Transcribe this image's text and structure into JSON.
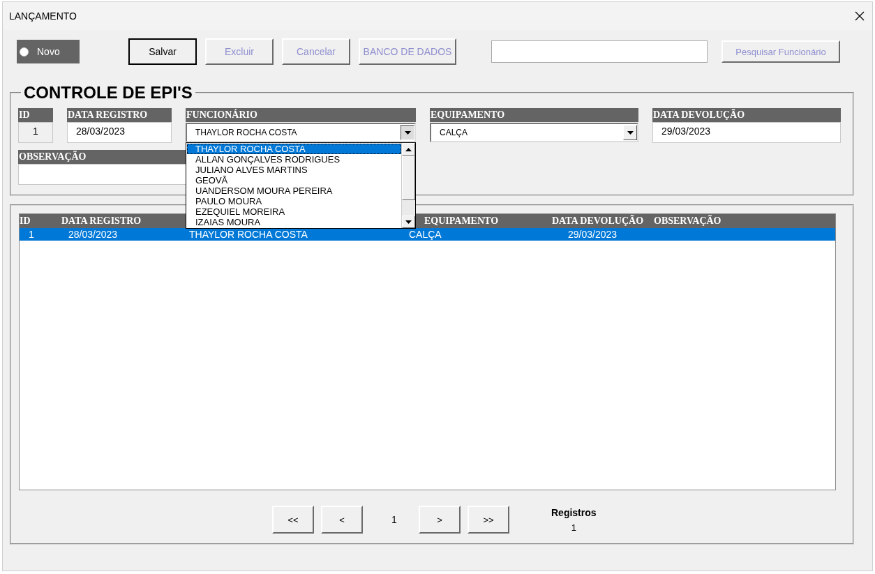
{
  "window": {
    "title": "LANÇAMENTO"
  },
  "toolbar": {
    "novo": {
      "label": "Novo",
      "checked": false
    },
    "buttons": [
      {
        "label": "Salvar",
        "disabled": false,
        "default": true
      },
      {
        "label": "Excluir",
        "disabled": true,
        "default": false
      },
      {
        "label": "Cancelar",
        "disabled": true,
        "default": false
      },
      {
        "label": "BANCO DE DADOS",
        "disabled": true,
        "default": false
      }
    ],
    "search_button": {
      "label": "Pesquisar Funcionário",
      "disabled": true
    }
  },
  "form": {
    "title": "CONTROLE DE EPI'S",
    "fields": [
      {
        "label": "ID",
        "value": "1",
        "kind": "readonly"
      },
      {
        "label": "DATA REGISTRO",
        "value": "28/03/2023",
        "kind": "text"
      },
      {
        "label": "FUNCIONÁRIO",
        "value": "THAYLOR ROCHA COSTA",
        "kind": "combo",
        "expanded": true
      },
      {
        "label": "EQUIPAMENTO",
        "value": "CALÇA",
        "kind": "combo",
        "expanded": false
      },
      {
        "label": "DATA DEVOLUÇÃO",
        "value": "29/03/2023",
        "kind": "text"
      },
      {
        "label": "OBSERVAÇÃO",
        "kind": "text"
      }
    ],
    "dropdown": [
      {
        "label": "THAYLOR ROCHA COSTA",
        "selected": true
      },
      {
        "label": "ALLAN GONÇALVES RODRIGUES",
        "selected": false
      },
      {
        "label": "JULIANO ALVES MARTINS",
        "selected": false
      },
      {
        "label": "GEOVÃ",
        "selected": false
      },
      {
        "label": "UANDERSOM MOURA PEREIRA",
        "selected": false
      },
      {
        "label": "PAULO MOURA",
        "selected": false
      },
      {
        "label": "EZEQUIEL MOREIRA",
        "selected": false
      },
      {
        "label": "IZAIAS MOURA",
        "selected": false
      }
    ]
  },
  "table": {
    "columns": [
      {
        "label": "ID"
      },
      {
        "label": "DATA REGISTRO"
      },
      {},
      {
        "label": "EQUIPAMENTO"
      },
      {
        "label": "DATA DEVOLUÇÃO"
      },
      {
        "label": "OBSERVAÇÃO"
      }
    ],
    "rows": [
      {
        "cells": [
          "1",
          "28/03/2023",
          "THAYLOR ROCHA COSTA",
          "CALÇA",
          "29/03/2023"
        ],
        "selected": true
      }
    ]
  },
  "pagination": {
    "first": "<<",
    "prev": "<",
    "page": "1",
    "next": ">",
    "last": ">>",
    "count_label": "Registros",
    "count": "1"
  }
}
